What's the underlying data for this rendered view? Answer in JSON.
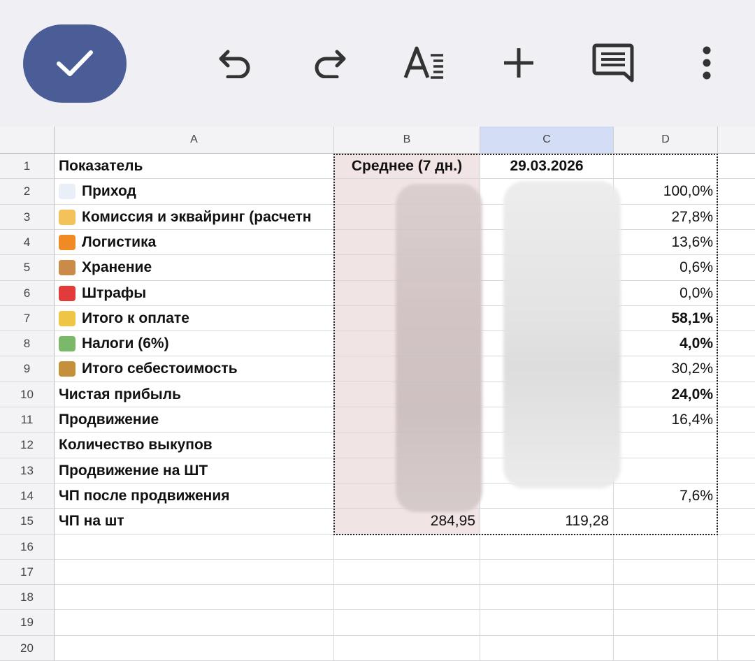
{
  "toolbar": {
    "confirm_icon": "check-icon",
    "undo_icon": "undo-icon",
    "redo_icon": "redo-icon",
    "format_icon": "text-format-icon",
    "insert_icon": "plus-icon",
    "comment_icon": "comment-icon",
    "more_icon": "more-vert-icon",
    "accent": "#4a5d97"
  },
  "columns": [
    "A",
    "B",
    "C",
    "D"
  ],
  "rows": [
    {
      "num": "1",
      "a": "Показатель",
      "b": "Среднее (7 дн.)",
      "c": "29.03.2026",
      "d": ""
    },
    {
      "num": "2",
      "a": "Приход",
      "b": "",
      "c": "",
      "d": "100,0%"
    },
    {
      "num": "3",
      "a": "Комиссия и эквайринг (расчетн",
      "b": "",
      "c": "",
      "d": "27,8%"
    },
    {
      "num": "4",
      "a": "Логистика",
      "b": "",
      "c": "",
      "d": "13,6%"
    },
    {
      "num": "5",
      "a": "Хранение",
      "b": "",
      "c": "",
      "d": "0,6%"
    },
    {
      "num": "6",
      "a": "Штрафы",
      "b": "",
      "c": "",
      "d": "0,0%"
    },
    {
      "num": "7",
      "a": "Итого к оплате",
      "b": "",
      "c": "",
      "d": "58,1%"
    },
    {
      "num": "8",
      "a": "Налоги (6%)",
      "b": "",
      "c": "",
      "d": "4,0%"
    },
    {
      "num": "9",
      "a": "Итого себестоимость",
      "b": "",
      "c": "",
      "d": "30,2%"
    },
    {
      "num": "10",
      "a": "Чистая прибыль",
      "b": "",
      "c": "",
      "d": "24,0%"
    },
    {
      "num": "11",
      "a": "Продвижение",
      "b": "",
      "c": "",
      "d": "16,4%"
    },
    {
      "num": "12",
      "a": "Количество выкупов",
      "b": "",
      "c": "",
      "d": ""
    },
    {
      "num": "13",
      "a": "Продвижение на ШТ",
      "b": "",
      "c": "",
      "d": ""
    },
    {
      "num": "14",
      "a": "ЧП после продвижения",
      "b": "",
      "c": "",
      "d": "7,6%"
    },
    {
      "num": "15",
      "a": "ЧП на шт",
      "b": "284,95",
      "c": "119,28",
      "d": ""
    },
    {
      "num": "16",
      "a": "",
      "b": "",
      "c": "",
      "d": ""
    },
    {
      "num": "17",
      "a": "",
      "b": "",
      "c": "",
      "d": ""
    },
    {
      "num": "18",
      "a": "",
      "b": "",
      "c": "",
      "d": ""
    },
    {
      "num": "19",
      "a": "",
      "b": "",
      "c": "",
      "d": ""
    },
    {
      "num": "20",
      "a": "",
      "b": "",
      "c": "",
      "d": ""
    }
  ],
  "row_icons": [
    "",
    "chart-increasing-icon",
    "handshake-icon",
    "delivery-truck-icon",
    "package-icon",
    "siren-icon",
    "credit-card-icon",
    "money-wings-icon",
    "money-bag-icon"
  ],
  "bold_d_rows": [
    7,
    8,
    10
  ],
  "selected_column": "C"
}
